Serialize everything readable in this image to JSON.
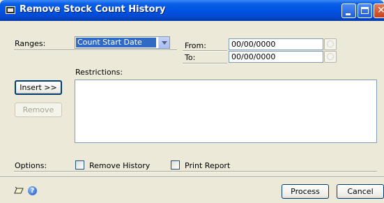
{
  "window": {
    "title": "Remove Stock Count History",
    "controls": [
      "minimize-icon",
      "maximize-icon",
      "close-icon"
    ]
  },
  "ranges": {
    "label": "Ranges:",
    "selected": "Count Start Date"
  },
  "from": {
    "label": "From:",
    "value": "00/00/0000"
  },
  "to": {
    "label": "To:",
    "value": "00/00/0000"
  },
  "restrictions": {
    "label": "Restrictions:"
  },
  "buttons": {
    "insert": "Insert >>",
    "remove": "Remove",
    "process": "Process",
    "cancel": "Cancel"
  },
  "options": {
    "label": "Options:",
    "remove_history": {
      "label": "Remove History",
      "checked": false
    },
    "print_report": {
      "label": "Print Report",
      "checked": false
    }
  },
  "footer_icons": [
    "note-icon",
    "help-icon"
  ],
  "colors": {
    "titlebar": "#0054e3",
    "selection": "#316ac5",
    "dialog_bg": "#ece9d8"
  }
}
